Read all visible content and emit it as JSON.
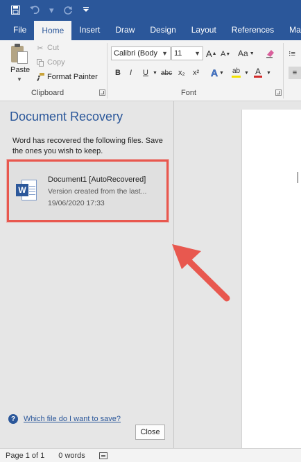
{
  "quick_access": {
    "save_icon": "save-icon",
    "undo_icon": "undo-icon",
    "redo_icon": "redo-icon",
    "customize_icon": "customize-qat-icon"
  },
  "tabs": [
    {
      "label": "File"
    },
    {
      "label": "Home"
    },
    {
      "label": "Insert"
    },
    {
      "label": "Draw"
    },
    {
      "label": "Design"
    },
    {
      "label": "Layout"
    },
    {
      "label": "References"
    },
    {
      "label": "Ma"
    }
  ],
  "active_tab": "Home",
  "clipboard": {
    "group_label": "Clipboard",
    "paste_label": "Paste",
    "cut_label": "Cut",
    "copy_label": "Copy",
    "format_painter_label": "Format Painter"
  },
  "font": {
    "group_label": "Font",
    "font_name": "Calibri (Body",
    "font_size": "11",
    "grow_label": "A",
    "shrink_label": "A",
    "case_label": "Aa",
    "bold": "B",
    "italic": "I",
    "underline": "U",
    "strike": "abc",
    "subscript": "x₂",
    "superscript": "x²",
    "text_effects": "A",
    "highlight": "ab",
    "font_color": "A"
  },
  "recovery": {
    "title": "Document Recovery",
    "description": "Word has recovered the following files. Save the ones you wish to keep.",
    "file": {
      "name": "Document1  [AutoRecovered]",
      "version": "Version created from the last...",
      "date": "19/06/2020 17:33"
    },
    "help_link": "Which file do I want to save?",
    "close_label": "Close"
  },
  "status": {
    "page": "Page 1 of 1",
    "words": "0 words"
  },
  "colors": {
    "brand_blue": "#2b579a",
    "highlight_red": "#e8584f",
    "ribbon_bg": "#f3f3f3"
  }
}
